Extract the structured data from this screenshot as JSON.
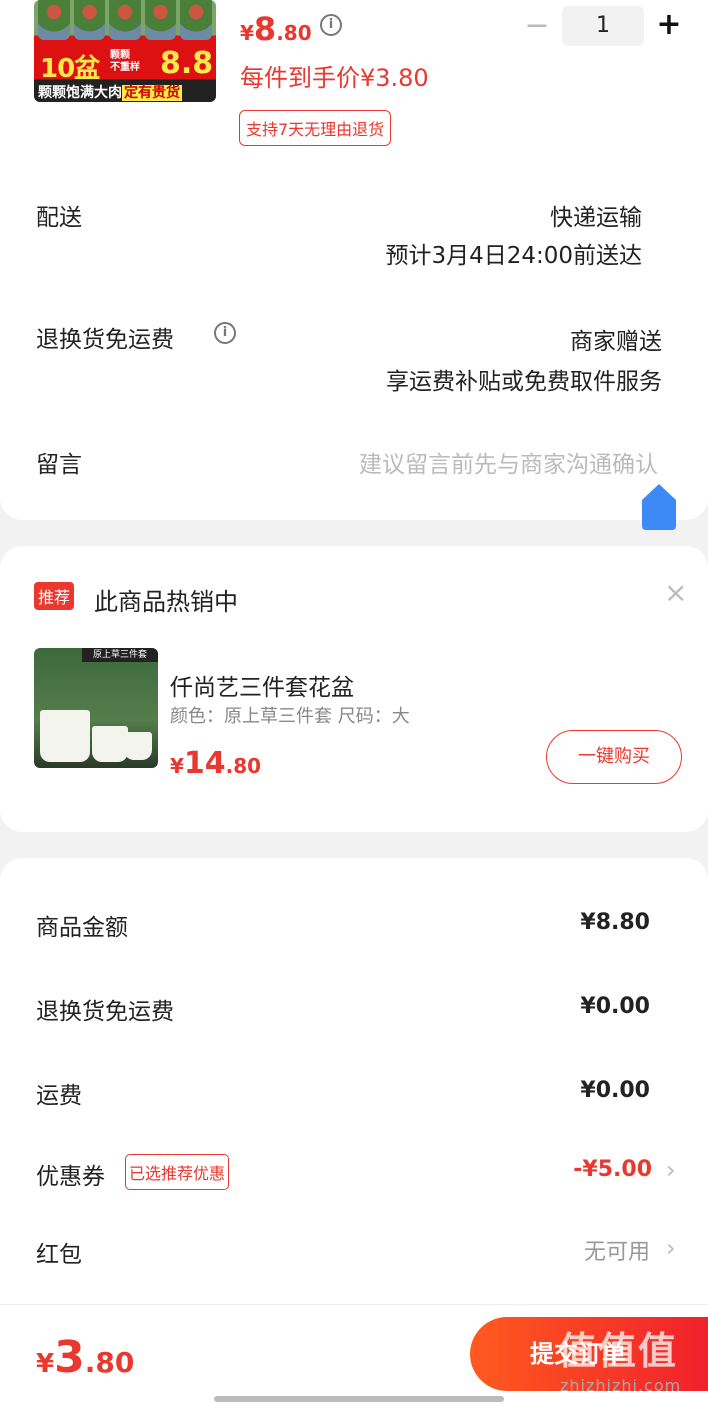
{
  "product": {
    "thumb_big": "10盆",
    "thumb_small_1": "颗颗",
    "thumb_small_2": "不重样",
    "thumb_price": "8.8",
    "thumb_caption": "颗颗饱满大肉",
    "thumb_caption_tag": "定有贵货",
    "price_symbol": "¥",
    "price_int": "8",
    "price_dec": ".80",
    "unit_price": "每件到手价¥3.80",
    "return_tag": "支持7天无理由退货",
    "quantity": "1",
    "minus": "−",
    "plus": "+"
  },
  "delivery": {
    "label": "配送",
    "method": "快递运输",
    "eta": "预计3月4日24:00前送达"
  },
  "return_shipping": {
    "label": "退换货免运费",
    "provider": "商家赠送",
    "desc": "享运费补贴或免费取件服务"
  },
  "message": {
    "label": "留言",
    "placeholder": "建议留言前先与商家沟通确认"
  },
  "recommend": {
    "tag": "推荐",
    "title": "此商品热销中",
    "close": "×",
    "image_banner": "原上草三件套",
    "name": "仟尚艺三件套花盆",
    "spec": "颜色：原上草三件套     尺码：大",
    "price_symbol": "¥",
    "price_int": "14",
    "price_dec": ".80",
    "buy_label": "一键购买"
  },
  "summary": {
    "goods_label": "商品金额",
    "goods_value": "¥8.80",
    "return_label": "退换货免运费",
    "return_value": "¥0.00",
    "shipping_label": "运费",
    "shipping_value": "¥0.00",
    "coupon_label": "优惠券",
    "coupon_tag": "已选推荐优惠",
    "coupon_value": "-¥5.00",
    "redpacket_label": "红包",
    "redpacket_value": "无可用",
    "chevron": "›"
  },
  "footer": {
    "total_symbol": "¥",
    "total_int": "3",
    "total_dec": ".80",
    "submit_label": "提交订单",
    "watermark": "值值值",
    "watermark_url": "zhizhizhi.com"
  },
  "colors": {
    "accent": "#e8382f",
    "background": "#f2f2f2"
  }
}
